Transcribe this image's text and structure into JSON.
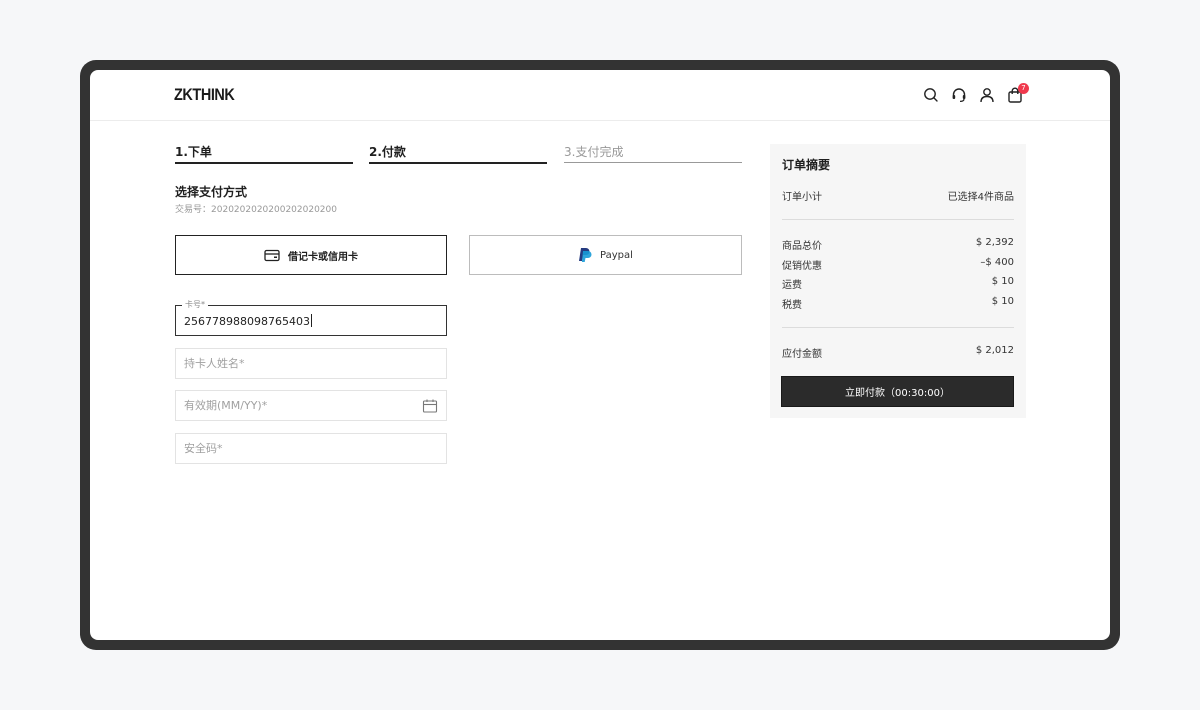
{
  "header": {
    "logo": "ZKTHINK",
    "icons": [
      "search-icon",
      "headset-icon",
      "user-icon",
      "cart-icon"
    ],
    "cart_count": "7"
  },
  "steps": [
    {
      "label": "1.下单",
      "state": "done"
    },
    {
      "label": "2.付款",
      "state": "done"
    },
    {
      "label": "3.支付完成",
      "state": "todo"
    }
  ],
  "payment": {
    "title": "选择支付方式",
    "order_label": "交易号：",
    "order_number": "2020202020200202020200",
    "methods": [
      {
        "label": "借记卡或信用卡",
        "icon": "card-icon",
        "selected": true
      },
      {
        "label": "Paypal",
        "icon": "paypal-icon",
        "selected": false
      }
    ]
  },
  "form": {
    "card_number_label": "卡号*",
    "card_number_value": "256778988098765403",
    "holder_placeholder": "持卡人姓名*",
    "expiry_placeholder": "有效期(MM/YY)*",
    "cvv_placeholder": "安全码*"
  },
  "summary": {
    "title": "订单摘要",
    "subtotal_label": "订单小计",
    "subtotal_value": "已选择4件商品",
    "lines": [
      {
        "label": "商品总价",
        "value": "$ 2,392"
      },
      {
        "label": "促销优惠",
        "value": "–$ 400"
      },
      {
        "label": "运费",
        "value": "$ 10"
      },
      {
        "label": "税费",
        "value": "$ 10"
      }
    ],
    "total_label": "应付金额",
    "total_value": "$ 2,012",
    "pay_button": "立即付款（00:30:00）"
  },
  "colors": {
    "accent": "#2b2b2b",
    "badge": "#f0394d",
    "paypal_dark": "#253b80",
    "paypal_light": "#179bd7"
  }
}
